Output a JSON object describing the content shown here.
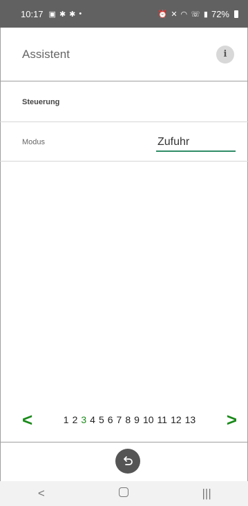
{
  "status_bar": {
    "time": "10:17",
    "battery": "72%",
    "left_icons": [
      "image-icon",
      "teams-icon",
      "teams-icon",
      "dot-icon"
    ],
    "right_icons": [
      "alarm-icon",
      "mute-icon",
      "wifi-icon",
      "call-signal-icon",
      "signal-icon"
    ]
  },
  "header": {
    "title": "Assistent",
    "info_icon": "info-icon"
  },
  "section": {
    "title": "Steuerung"
  },
  "mode": {
    "label": "Modus",
    "value": "Zufuhr"
  },
  "pager": {
    "prev": "<",
    "next": ">",
    "pages": [
      "1",
      "2",
      "3",
      "4",
      "5",
      "6",
      "7",
      "8",
      "9",
      "10",
      "11",
      "12",
      "13"
    ],
    "active_index": 2
  },
  "nav_bar": {
    "back": "<",
    "recents": "|||"
  },
  "colors": {
    "accent": "#1a8a1a",
    "field_underline": "#2e8b66",
    "status_bar": "#616161"
  }
}
